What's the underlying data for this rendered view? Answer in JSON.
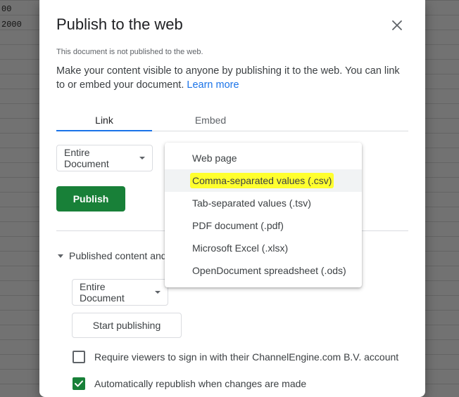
{
  "background_sheet": {
    "cells": [
      "00",
      "2000"
    ]
  },
  "dialog": {
    "title": "Publish to the web",
    "close_icon": "close-icon",
    "status_note": "This document is not published to the web.",
    "description": "Make your content visible to anyone by publishing it to the web. You can link to or embed your document.",
    "learn_more": "Learn more",
    "tabs": {
      "link": "Link",
      "embed": "Embed"
    },
    "scope_select": "Entire Document",
    "publish_button": "Publish",
    "published_section_label": "Published content and",
    "published_scope_select": "Entire Document",
    "start_publishing_button": "Start publishing",
    "options": [
      {
        "label": "Require viewers to sign in with their ChannelEngine.com B.V. account",
        "checked": false
      },
      {
        "label": "Automatically republish when changes are made",
        "checked": true
      }
    ]
  },
  "format_menu": {
    "items": [
      {
        "label": "Web page"
      },
      {
        "label": "Comma-separated values (.csv)"
      },
      {
        "label": "Tab-separated values (.tsv)"
      },
      {
        "label": "PDF document (.pdf)"
      },
      {
        "label": "Microsoft Excel (.xlsx)"
      },
      {
        "label": "OpenDocument spreadsheet (.ods)"
      }
    ]
  },
  "colors": {
    "primary_green": "#188038",
    "link_blue": "#1a73e8",
    "highlight_yellow": "#ffff2e"
  }
}
